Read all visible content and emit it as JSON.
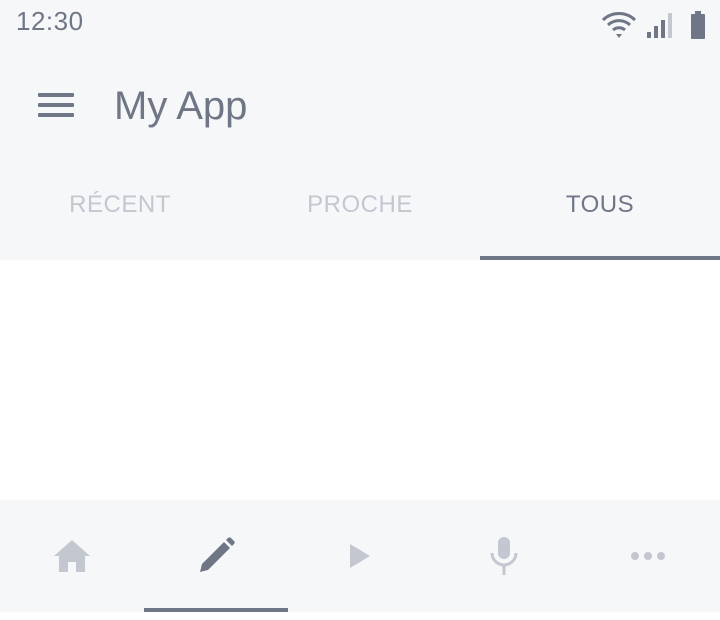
{
  "status_bar": {
    "time": "12:30",
    "icons": [
      "wifi-icon",
      "signal-icon",
      "battery-icon"
    ]
  },
  "app_bar": {
    "menu_icon": "menu-icon",
    "title": "My App"
  },
  "tabs": [
    {
      "label": "RÉCENT",
      "active": false
    },
    {
      "label": "PROCHE",
      "active": false
    },
    {
      "label": "TOUS",
      "active": true
    }
  ],
  "bottom_nav": [
    {
      "icon": "home-icon",
      "active": false
    },
    {
      "icon": "pencil-icon",
      "active": true
    },
    {
      "icon": "play-icon",
      "active": false
    },
    {
      "icon": "microphone-icon",
      "active": false
    },
    {
      "icon": "more-icon",
      "active": false
    }
  ],
  "colors": {
    "bar_background": "#f6f7f9",
    "active": "#6f7787",
    "inactive": "#c3c7d0",
    "content_background": "#ffffff"
  }
}
